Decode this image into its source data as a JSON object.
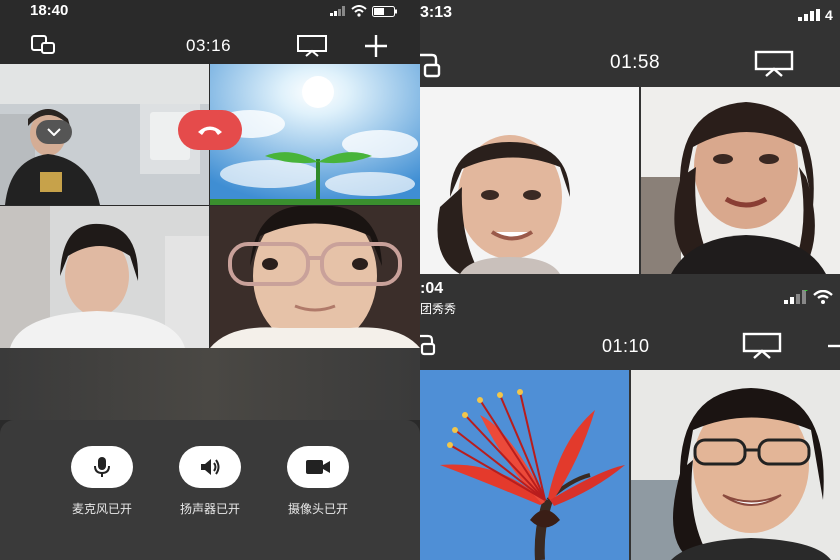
{
  "left_screen": {
    "status_time": "18:40",
    "call_timer": "03:16",
    "controls": {
      "mic_label": "麦克风已开",
      "speaker_label": "扬声器已开",
      "camera_label": "摄像头已开"
    }
  },
  "top_right_screen": {
    "status_time": "3:13",
    "status_extra": "4",
    "call_timer": "01:58"
  },
  "bottom_right_screen": {
    "status_time": ":04",
    "caller_name": "团秀秀",
    "call_timer": "01:10"
  },
  "icons": {
    "minimize": "window-minimize-icon",
    "screen_share": "screen-share-icon",
    "add": "add-participant-icon",
    "mic": "microphone-icon",
    "speaker": "speaker-icon",
    "camera": "video-camera-icon",
    "hangup": "phone-hangup-icon",
    "collapse": "chevron-down-icon"
  },
  "colors": {
    "hangup": "#e54b4b",
    "sheet": "#3a3a3a",
    "panel": "#2a2a2a"
  }
}
